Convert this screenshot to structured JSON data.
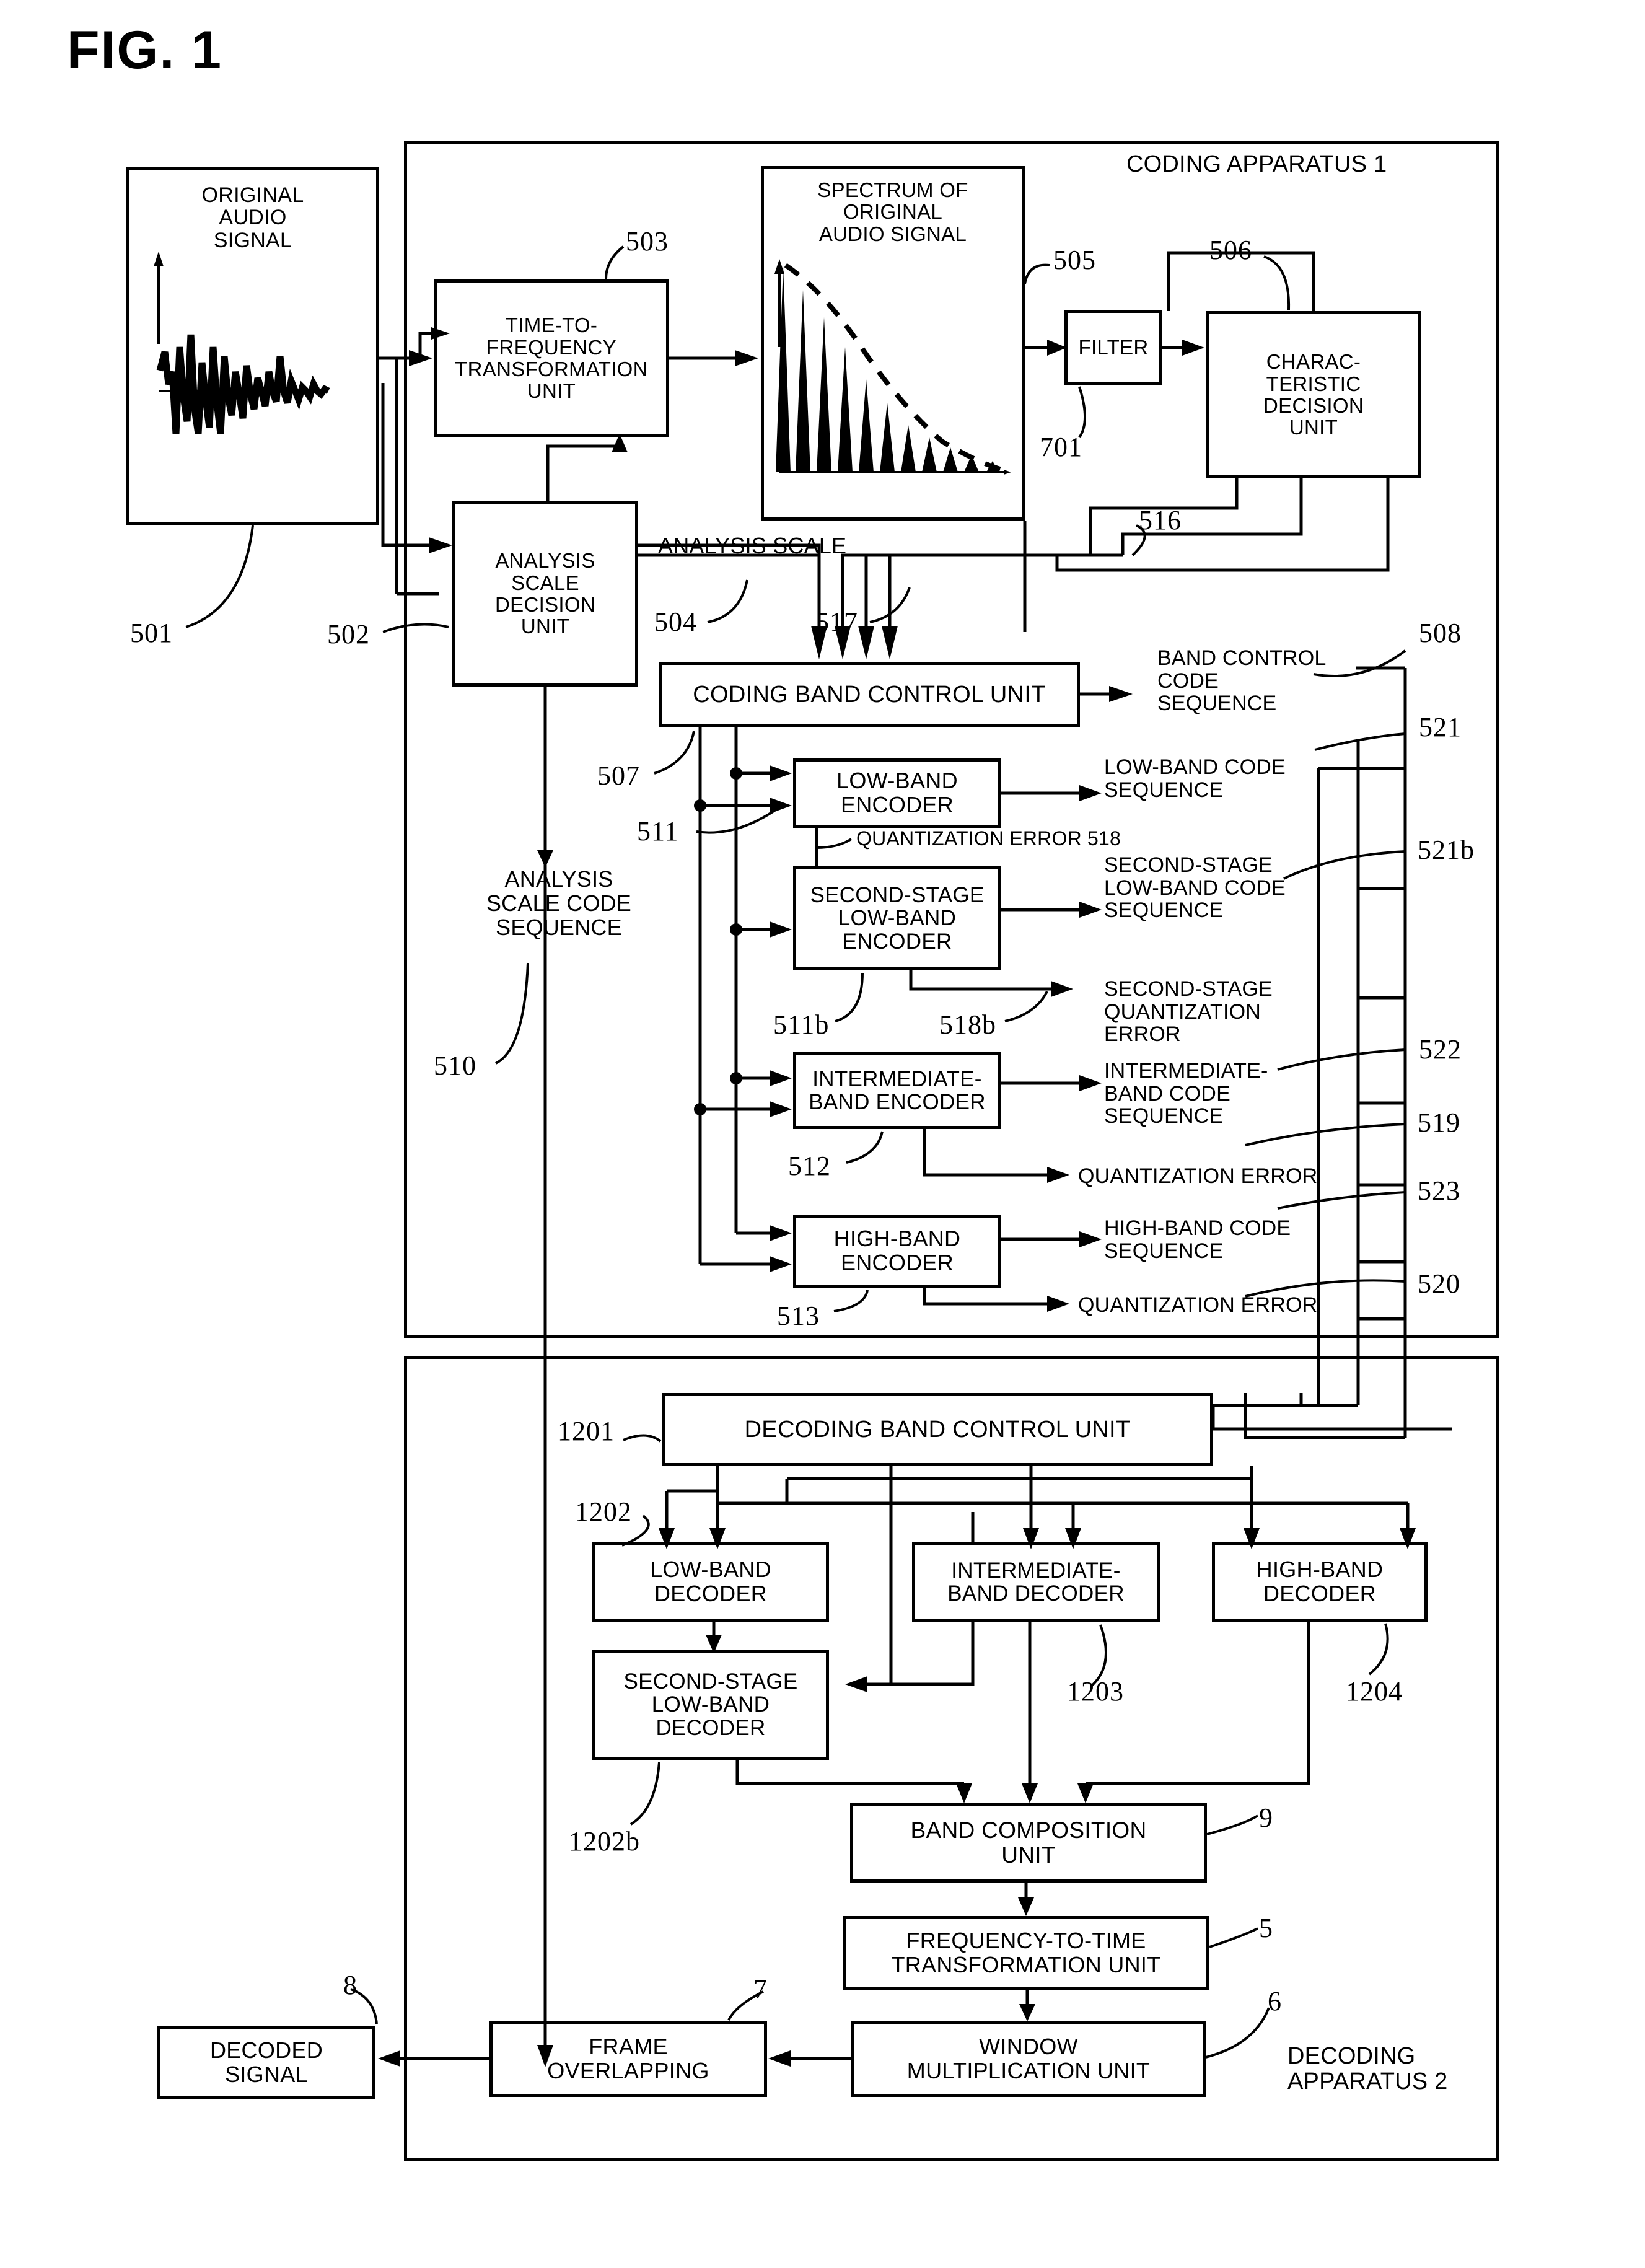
{
  "figure": {
    "title": "FIG. 1"
  },
  "coding_apparatus": {
    "label": "CODING APPARATUS 1",
    "blocks": {
      "original_audio_signal": "ORIGINAL\nAUDIO\nSIGNAL",
      "time_to_frequency": "TIME-TO-\nFREQUENCY\nTRANSFORMATION\nUNIT",
      "spectrum": "SPECTRUM OF\nORIGINAL\nAUDIO SIGNAL",
      "filter": "FILTER",
      "characteristic_decision": "CHARAC-\nTERISTIC\nDECISION\nUNIT",
      "analysis_scale_decision": "ANALYSIS\nSCALE\nDECISION\nUNIT",
      "coding_band_control": "CODING BAND CONTROL UNIT",
      "low_band_encoder": "LOW-BAND\nENCODER",
      "second_stage_low_band_encoder": "SECOND-STAGE\nLOW-BAND\nENCODER",
      "intermediate_band_encoder": "INTERMEDIATE-\nBAND ENCODER",
      "high_band_encoder": "HIGH-BAND\nENCODER"
    },
    "annotations": {
      "analysis_scale": "ANALYSIS SCALE",
      "analysis_scale_code_sequence": "ANALYSIS\nSCALE CODE\nSEQUENCE",
      "band_control_code_sequence": "BAND CONTROL\nCODE\nSEQUENCE",
      "low_band_code_sequence": "LOW-BAND CODE\nSEQUENCE",
      "quantization_error_518": "QUANTIZATION ERROR 518",
      "second_stage_low_band_code_sequence": "SECOND-STAGE\nLOW-BAND CODE\nSEQUENCE",
      "second_stage_quantization_error": "SECOND-STAGE\nQUANTIZATION\nERROR",
      "intermediate_band_code_sequence": "INTERMEDIATE-\nBAND CODE\nSEQUENCE",
      "quantization_error_intermediate": "QUANTIZATION ERROR",
      "high_band_code_sequence": "HIGH-BAND CODE\nSEQUENCE",
      "quantization_error_high": "QUANTIZATION ERROR"
    },
    "refs": {
      "r501": "501",
      "r502": "502",
      "r503": "503",
      "r504": "504",
      "r505": "505",
      "r506": "506",
      "r507": "507",
      "r508": "508",
      "r510": "510",
      "r511": "511",
      "r511b": "511b",
      "r512": "512",
      "r513": "513",
      "r516": "516",
      "r517": "517",
      "r518b": "518b",
      "r519": "519",
      "r520": "520",
      "r521": "521",
      "r521b": "521b",
      "r522": "522",
      "r523": "523",
      "r701": "701"
    }
  },
  "decoding_apparatus": {
    "label": "DECODING\nAPPARATUS 2",
    "blocks": {
      "decoding_band_control": "DECODING BAND CONTROL UNIT",
      "low_band_decoder": "LOW-BAND\nDECODER",
      "second_stage_low_band_decoder": "SECOND-STAGE\nLOW-BAND\nDECODER",
      "intermediate_band_decoder": "INTERMEDIATE-\nBAND DECODER",
      "high_band_decoder": "HIGH-BAND\nDECODER",
      "band_composition": "BAND COMPOSITION\nUNIT",
      "frequency_to_time": "FREQUENCY-TO-TIME\nTRANSFORMATION UNIT",
      "window_multiplication": "WINDOW\nMULTIPLICATION UNIT",
      "frame_overlapping": "FRAME\nOVERLAPPING",
      "decoded_signal": "DECODED\nSIGNAL"
    },
    "refs": {
      "r1201": "1201",
      "r1202": "1202",
      "r1202b": "1202b",
      "r1203": "1203",
      "r1204": "1204",
      "r9": "9",
      "r5": "5",
      "r6": "6",
      "r7": "7",
      "r8": "8"
    }
  },
  "colors": {
    "ink": "#000000",
    "paper": "#ffffff"
  }
}
